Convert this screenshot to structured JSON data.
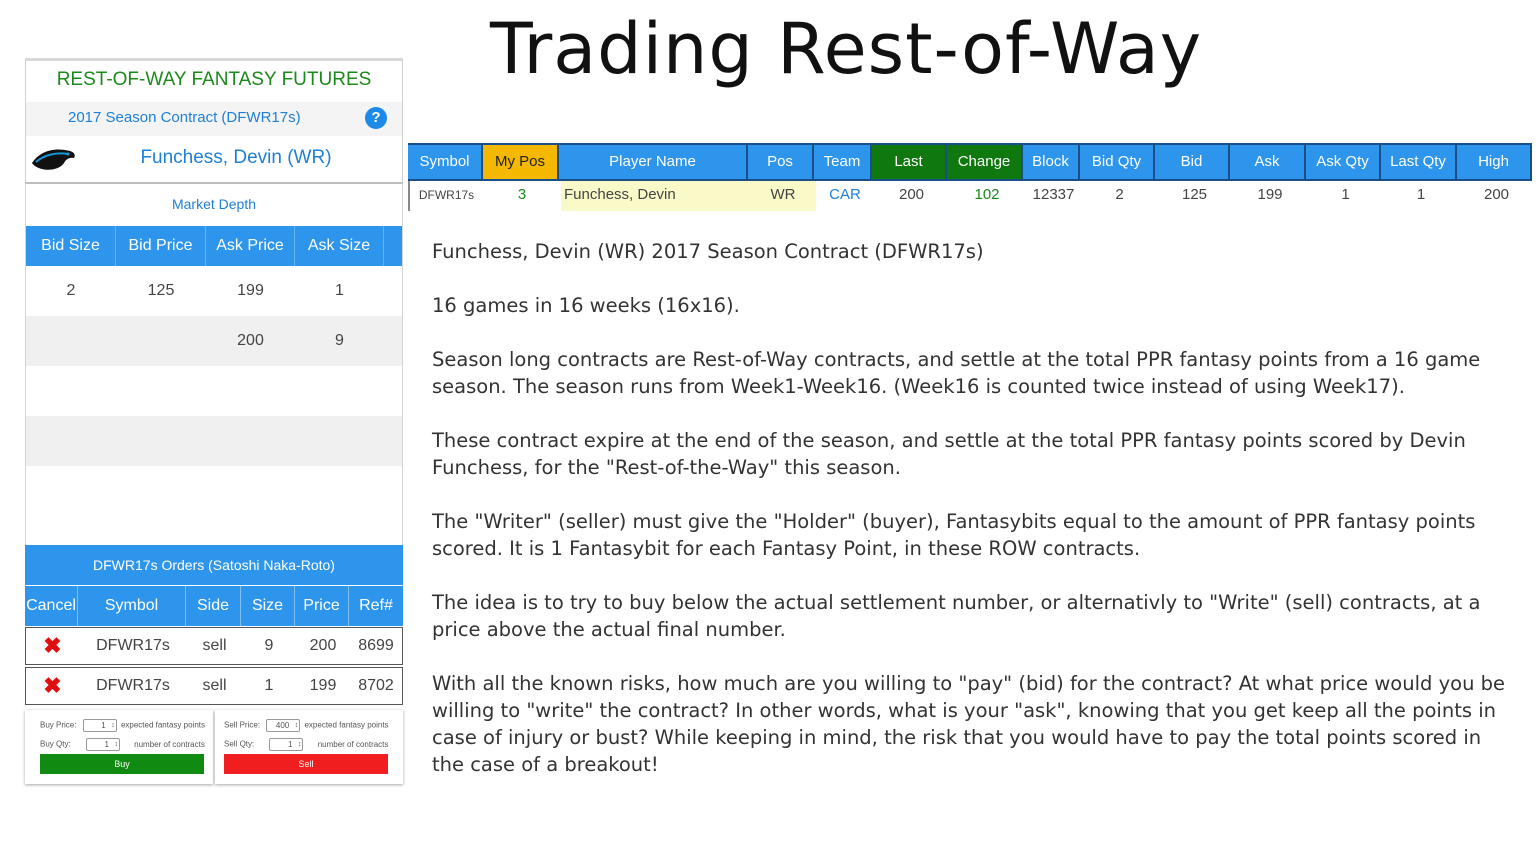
{
  "slide_title": "Trading Rest-of-Way",
  "panel": {
    "brand": "REST-OF-WAY FANTASY FUTURES",
    "contract": "2017  Season Contract  (DFWR17s)",
    "help_icon": "?",
    "team_logo_icon": "panthers-logo",
    "player": "Funchess, Devin (WR)"
  },
  "market_depth": {
    "title": "Market Depth",
    "headers": [
      "Bid Size",
      "Bid Price",
      "Ask Price",
      "Ask Size"
    ],
    "rows": [
      [
        "2",
        "125",
        "199",
        "1"
      ],
      [
        "",
        "",
        "200",
        "9"
      ]
    ]
  },
  "orders": {
    "title": "DFWR17s Orders (Satoshi Naka-Roto)",
    "headers": [
      "Cancel",
      "Symbol",
      "Side",
      "Size",
      "Price",
      "Ref#"
    ],
    "rows": [
      {
        "cancel": "✖",
        "symbol": "DFWR17s",
        "side": "sell",
        "size": "9",
        "price": "200",
        "ref": "8699"
      },
      {
        "cancel": "✖",
        "symbol": "DFWR17s",
        "side": "sell",
        "size": "1",
        "price": "199",
        "ref": "8702"
      }
    ]
  },
  "buy_form": {
    "price_label": "Buy Price:",
    "price_value": "1",
    "price_hint": "expected fantasy points",
    "qty_label": "Buy Qty:",
    "qty_value": "1",
    "qty_hint": "number of contracts",
    "button": "Buy"
  },
  "sell_form": {
    "price_label": "Sell Price:",
    "price_value": "400",
    "price_hint": "expected fantasy points",
    "qty_label": "Sell Qty:",
    "qty_value": "1",
    "qty_hint": "number of contracts",
    "button": "Sell"
  },
  "quote": {
    "headers": [
      "Symbol",
      "My Pos",
      "Player Name",
      "Pos",
      "Team",
      "Last",
      "Change",
      "Block",
      "Bid Qty",
      "Bid",
      "Ask",
      "Ask Qty",
      "Last Qty",
      "High"
    ],
    "row": [
      "DFWR17s",
      "3",
      "Funchess, Devin",
      "WR",
      "CAR",
      "200",
      "102",
      "12337",
      "2",
      "125",
      "199",
      "1",
      "1",
      "200"
    ]
  },
  "body": {
    "p1": "Funchess, Devin (WR) 2017  Season Contract  (DFWR17s)",
    "p2": "16 games in 16 weeks (16x16).",
    "p3": "Season long contracts are Rest-of-Way contracts, and settle at the total PPR fantasy points  from a 16 game season. The season runs from Week1-Week16. (Week16 is counted twice instead of using Week17).",
    "p4": "These contract expire at the end of the season, and settle at the total PPR fantasy points scored by Devin Funchess, for the \"Rest-of-the-Way\" this season.",
    "p5": "The \"Writer\" (seller) must give the \"Holder\" (buyer), Fantasybits equal to the amount of PPR fantasy points scored. It is 1 Fantasybit for each Fantasy Point, in these ROW contracts.",
    "p6": "The idea is to try to buy below the actual settlement number, or alternativly to \"Write\" (sell) contracts, at a price above the actual final number.",
    "p7": "With all the known risks, how much are you willing to \"pay\" (bid) for the contract? At what price would you be willing to  \"write\" the contract? In other words, what is your \"ask\", knowing that you get keep all the points in case of injury or bust? While keeping in mind, the risk that you would have to pay the total points scored in the case of a breakout!"
  }
}
